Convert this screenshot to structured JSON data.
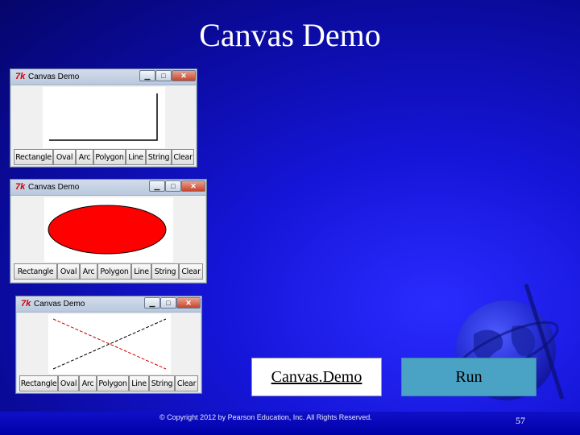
{
  "slide": {
    "title": "Canvas Demo",
    "link_label": "Canvas.Demo",
    "run_label": "Run",
    "copyright": "© Copyright 2012 by Pearson Education, Inc. All Rights Reserved.",
    "page_number": "57"
  },
  "windows": [
    {
      "title": "Canvas Demo",
      "logo": "7k",
      "drawing": "rectangle",
      "buttons": [
        "Rectangle",
        "Oval",
        "Arc",
        "Polygon",
        "Line",
        "String",
        "Clear"
      ]
    },
    {
      "title": "Canvas Demo",
      "logo": "7k",
      "drawing": "oval",
      "buttons": [
        "Rectangle",
        "Oval",
        "Arc",
        "Polygon",
        "Line",
        "String",
        "Clear"
      ]
    },
    {
      "title": "Canvas Demo",
      "logo": "7k",
      "drawing": "lines",
      "buttons": [
        "Rectangle",
        "Oval",
        "Arc",
        "Polygon",
        "Line",
        "String",
        "Clear"
      ]
    }
  ],
  "window_controls": {
    "minimize": "▁",
    "maximize": "□",
    "close": "✕"
  },
  "colors": {
    "background": "#1515d8",
    "oval_fill": "#ff0000",
    "run_button": "#4aa3c4"
  }
}
